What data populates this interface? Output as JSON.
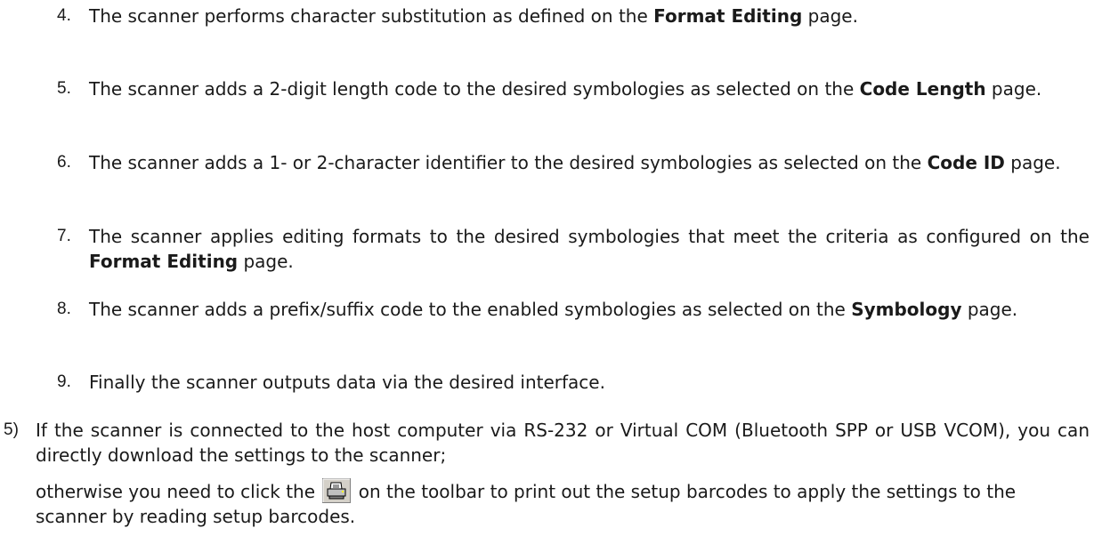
{
  "steps": [
    {
      "num": "4.",
      "pre": "The scanner performs character substitution as defined on the ",
      "bold": "Format Editing",
      "post": " page."
    },
    {
      "num": "5.",
      "pre": "The scanner adds a 2-digit length code to the desired symbologies as selected on the ",
      "bold": "Code Length",
      "post": " page."
    },
    {
      "num": "6.",
      "pre": "The scanner adds a 1- or 2-character identifier to the desired symbologies as selected on the ",
      "bold": "Code ID",
      "post": " page."
    },
    {
      "num": "7.",
      "pre": "The scanner applies editing formats to the desired symbologies that meet the criteria as configured on the ",
      "bold": "Format Editing",
      "post": " page."
    },
    {
      "num": "8.",
      "pre": "The scanner adds a prefix/suffix code to the enabled symbologies as selected on the ",
      "bold": "Symbology",
      "post": " page."
    },
    {
      "num": "9.",
      "text": "Finally the scanner outputs data via the desired interface."
    }
  ],
  "outer": {
    "num": "5)",
    "line1": "If the scanner is connected to the host computer via RS-232 or Virtual COM (Bluetooth SPP or USB VCOM), you can directly download the settings to the scanner;",
    "line2_pre": "otherwise you need to click the",
    "line2_post": "on the toolbar to print out the setup barcodes to apply the settings to the scanner by reading setup barcodes."
  },
  "icons": {
    "toolbar_button": "printer-icon"
  }
}
